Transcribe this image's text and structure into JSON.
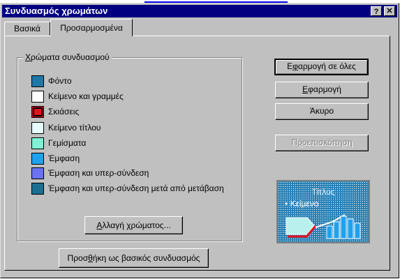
{
  "window": {
    "title": "Συνδυασμός χρωμάτων",
    "help_label": "?",
    "close_label": "✕"
  },
  "tabs": [
    {
      "label": "Βασικά",
      "selected": false
    },
    {
      "label": "Προσαρμοσμένα",
      "selected": true
    }
  ],
  "scheme_group": {
    "legend_first": "Χ",
    "legend_rest": "ρώματα συνδυασμού",
    "items": [
      {
        "label": "Φόντο",
        "color": "#1f77a8",
        "selected": false
      },
      {
        "label": "Κείμενο και γραμμές",
        "color": "#ffffff",
        "selected": false
      },
      {
        "label": "Σκιάσεις",
        "color": "#e8101a",
        "selected": true
      },
      {
        "label": "Κείμενο τίτλου",
        "color": "#e6fbff",
        "selected": false
      },
      {
        "label": "Γεμίσματα",
        "color": "#7ff2d4",
        "selected": false
      },
      {
        "label": "Έμφαση",
        "color": "#1fa2ee",
        "selected": false
      },
      {
        "label": "Έμφαση και υπερ-σύνδεση",
        "color": "#6b72f0",
        "selected": false
      },
      {
        "label": "Έμφαση και υπερ-σύνδεση μετά από μετάβαση",
        "color": "#1b6f93",
        "selected": false
      }
    ]
  },
  "buttons": {
    "apply_all": {
      "pre": "Ε",
      "ul": "φ",
      "post": "αρμογή σε όλες"
    },
    "apply": {
      "ul": "Ε",
      "post": "φαρμογή"
    },
    "cancel": {
      "label": "Άκυρο"
    },
    "preview": {
      "pre": "Π",
      "ul": "ρ",
      "post": "οεπισκόπηση"
    },
    "change_color": {
      "ul": "Α",
      "post": "λλαγή χρώματος..."
    },
    "add_standard": {
      "pre": "Προσ",
      "ul": "θ",
      "post": "ήκη ως βασικός συνδυασμός"
    }
  },
  "preview": {
    "title": "Τίτλος",
    "bullet": "• Κείμενο",
    "colors": {
      "bg": "#2a83b8",
      "shape": "#b9f0ee",
      "shadow": "#e8101a",
      "bar": "#1fa2ee",
      "line": "#ffffff"
    }
  }
}
